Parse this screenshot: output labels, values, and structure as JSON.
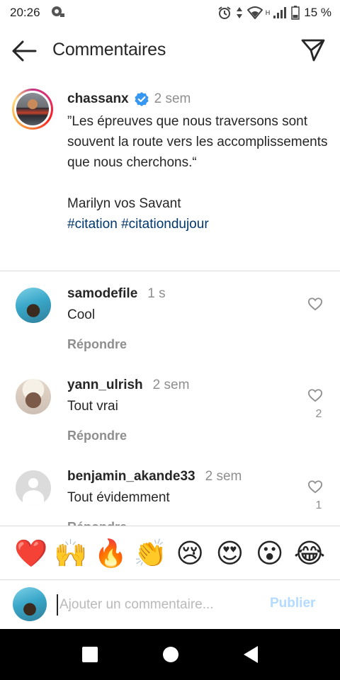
{
  "status_bar": {
    "time": "20:26",
    "network_type": "H",
    "battery_percent": "15 %",
    "icons": [
      "notification-icon",
      "alarm-icon",
      "data-arrows-icon",
      "wifi-icon",
      "signal-icon",
      "battery-icon"
    ]
  },
  "header": {
    "title": "Commentaires",
    "back_icon": "arrow-left-icon",
    "send_icon": "paper-plane-icon"
  },
  "post": {
    "username": "chassanx",
    "verified": true,
    "time": "2 sem",
    "caption": "”Les épreuves que nous traversons sont souvent la route vers les accomplissements que nous cherchons.“\n\nMarilyn vos Savant",
    "hashtags": [
      "#citation",
      "#citationdujour"
    ]
  },
  "comments": [
    {
      "username": "samodefile",
      "time": "1 s",
      "text": "Cool",
      "reply_label": "Répondre",
      "likes": ""
    },
    {
      "username": "yann_ulrish",
      "time": "2 sem",
      "text": "Tout vrai",
      "reply_label": "Répondre",
      "likes": "2"
    },
    {
      "username": "benjamin_akande33",
      "time": "2 sem",
      "text": "Tout évidemment",
      "reply_label": "Répondre",
      "likes": "1"
    }
  ],
  "reactions": [
    "❤️",
    "🙌",
    "🔥",
    "👏",
    "😢",
    "😍",
    "😮",
    "😂"
  ],
  "comment_input": {
    "placeholder": "Ajouter un commentaire...",
    "value": "",
    "publish_label": "Publier"
  },
  "nav_bar": {
    "items": [
      "recent-apps-icon",
      "home-icon",
      "back-icon"
    ]
  },
  "colors": {
    "link": "#00376b",
    "secondary_text": "#8e8e8e",
    "publish_disabled": "#b3dbff",
    "verified": "#3897f0"
  }
}
